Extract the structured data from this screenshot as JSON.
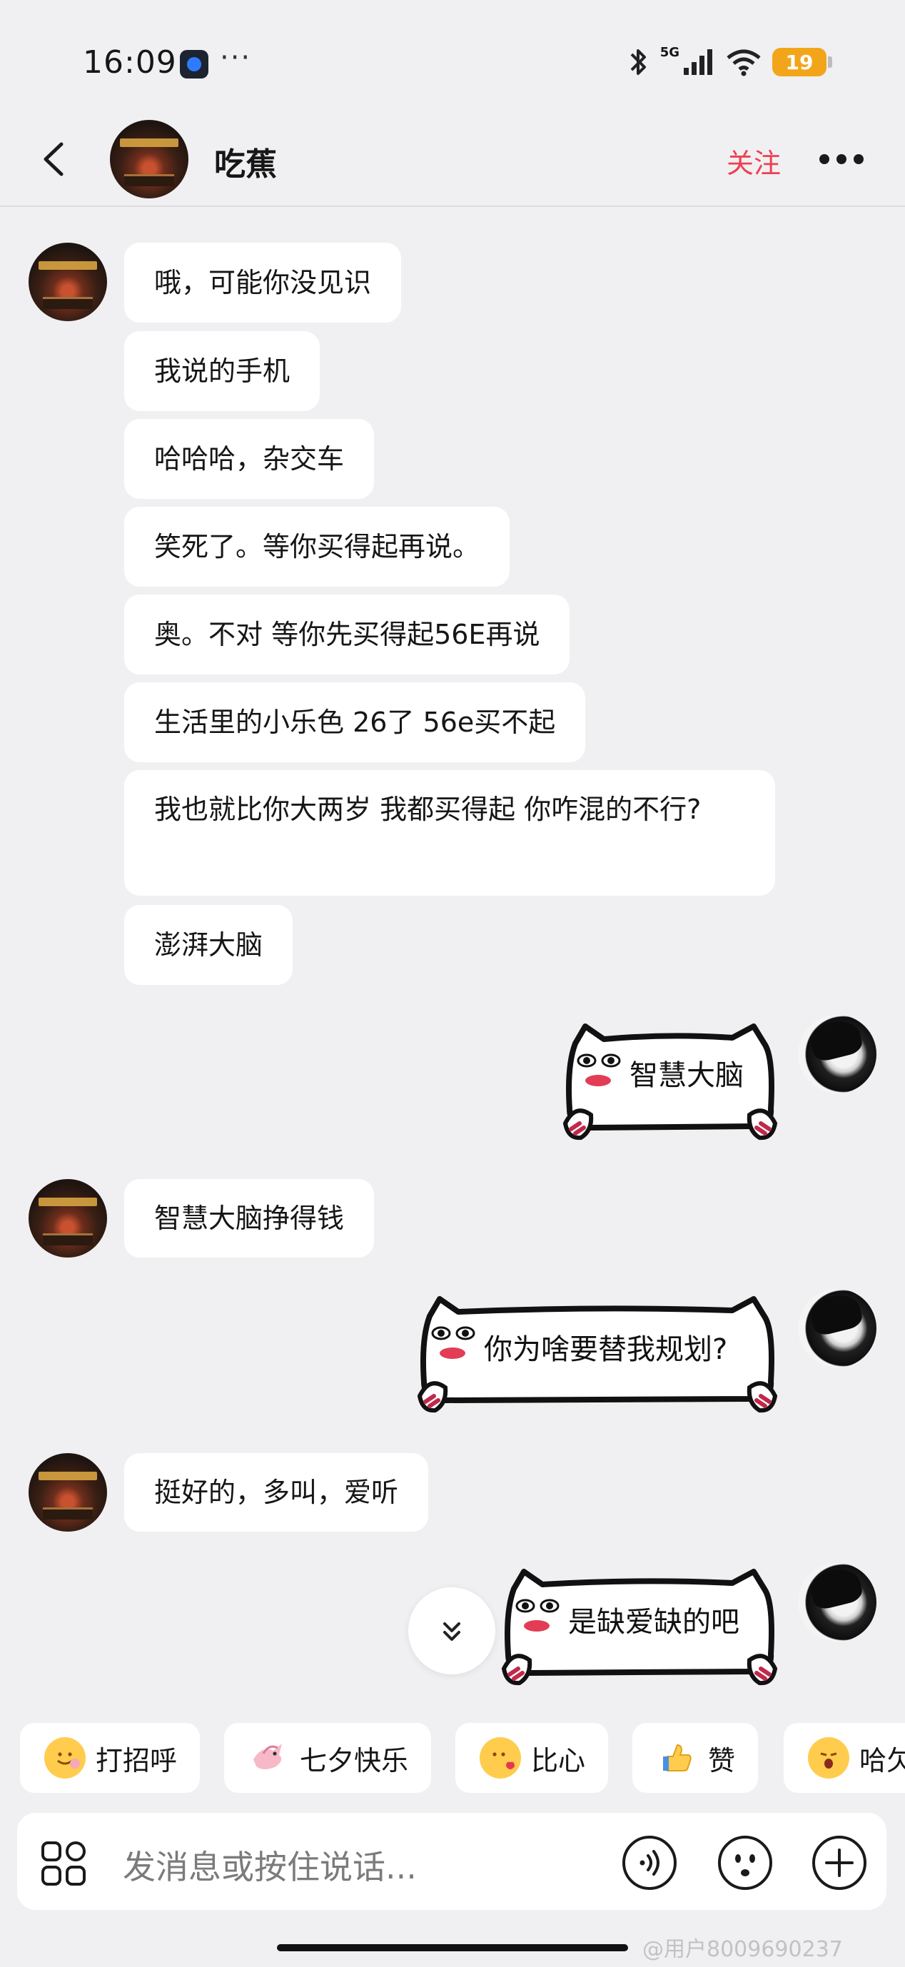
{
  "status_bar": {
    "time": "16:09",
    "more_dots": "···",
    "network": "5G",
    "battery": "19",
    "icons": [
      "app-paw-icon",
      "bluetooth-icon",
      "signal-icon",
      "wifi-icon",
      "battery-icon"
    ]
  },
  "header": {
    "contact_name": "吃蕉",
    "follow_label": "关注",
    "icons": [
      "back-arrow-icon",
      "more-dots-icon"
    ]
  },
  "messages": [
    {
      "sender": "other",
      "type": "text",
      "text": "哦，可能你没见识"
    },
    {
      "sender": "other",
      "type": "text",
      "text": "我说的手机"
    },
    {
      "sender": "other",
      "type": "text",
      "text": "哈哈哈，杂交车"
    },
    {
      "sender": "other",
      "type": "text",
      "text": "笑死了。等你买得起再说。"
    },
    {
      "sender": "other",
      "type": "text",
      "text": "奥。不对   等你先买得起56E再说"
    },
    {
      "sender": "other",
      "type": "text",
      "text": "生活里的小乐色   26了   56e买不起"
    },
    {
      "sender": "other",
      "type": "text",
      "text": "我也就比你大两岁  我都买得起   你咋混的不行?"
    },
    {
      "sender": "other",
      "type": "text",
      "text": "澎湃大脑"
    },
    {
      "sender": "me",
      "type": "sticker",
      "text": "智慧大脑"
    },
    {
      "sender": "other",
      "type": "text",
      "text": "智慧大脑挣得钱"
    },
    {
      "sender": "me",
      "type": "sticker",
      "text": "你为啥要替我规划?"
    },
    {
      "sender": "other",
      "type": "text",
      "text": "挺好的，多叫，爱听"
    },
    {
      "sender": "me",
      "type": "sticker",
      "text": "是缺爱缺的吧"
    }
  ],
  "quick_replies": [
    {
      "label": "打招呼",
      "icon": "wave-emoji-icon"
    },
    {
      "label": "七夕快乐",
      "icon": "bird-emoji-icon"
    },
    {
      "label": "比心",
      "icon": "heart-hands-emoji-icon"
    },
    {
      "label": "赞",
      "icon": "thumbs-up-emoji-icon"
    },
    {
      "label": "哈欠",
      "icon": "yawn-emoji-icon"
    }
  ],
  "input": {
    "placeholder": "发消息或按住说话..."
  },
  "watermark": "@用户8009690237",
  "colors": {
    "background": "#f0f0f2",
    "bubble": "#ffffff",
    "follow_accent": "#ee3f52",
    "battery": "#f3a51a"
  }
}
